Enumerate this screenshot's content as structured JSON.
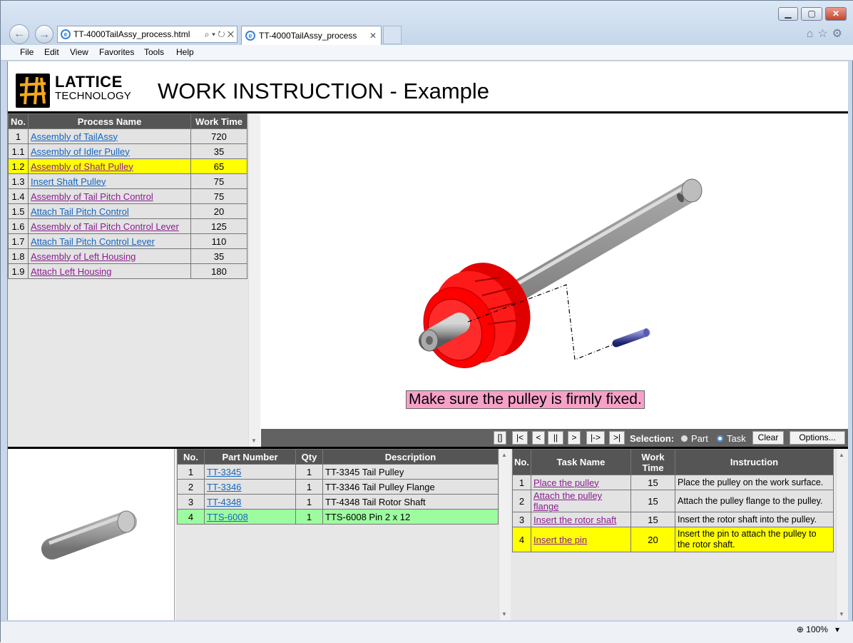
{
  "window": {
    "address": "TT-4000TailAssy_process.html",
    "tab_title": "TT-4000TailAssy_process",
    "zoom": "100%"
  },
  "menu": [
    "File",
    "Edit",
    "View",
    "Favorites",
    "Tools",
    "Help"
  ],
  "header": {
    "logo_line1": "LATTICE",
    "logo_line2": "TECHNOLOGY",
    "title": "WORK INSTRUCTION - Example"
  },
  "process_table": {
    "columns": [
      "No.",
      "Process Name",
      "Work Time"
    ],
    "rows": [
      {
        "no": "1",
        "name": "Assembly of TailAssy",
        "time": "720",
        "visited": false
      },
      {
        "no": "1.1",
        "name": "Assembly of Idler Pulley",
        "time": "35",
        "visited": false
      },
      {
        "no": "1.2",
        "name": "Assembly of Shaft Pulley",
        "time": "65",
        "visited": true,
        "selected": true
      },
      {
        "no": "1.3",
        "name": "Insert Shaft Pulley",
        "time": "75",
        "visited": false
      },
      {
        "no": "1.4",
        "name": "Assembly of Tail Pitch Control",
        "time": "75",
        "visited": true
      },
      {
        "no": "1.5",
        "name": "Attach Tail Pitch Control",
        "time": "20",
        "visited": false
      },
      {
        "no": "1.6",
        "name": "Assembly of Tail Pitch Control Lever",
        "time": "125",
        "visited": true
      },
      {
        "no": "1.7",
        "name": "Attach Tail Pitch Control Lever",
        "time": "110",
        "visited": false
      },
      {
        "no": "1.8",
        "name": "Assembly of Left Housing",
        "time": "35",
        "visited": true
      },
      {
        "no": "1.9",
        "name": "Attach Left Housing",
        "time": "180",
        "visited": true
      }
    ]
  },
  "viewer": {
    "caption": "Make sure the pulley is firmly fixed.",
    "controls": [
      "[]",
      "|<",
      "<",
      "||",
      ">",
      "|->",
      ">|"
    ],
    "selection_label": "Selection:",
    "radio_part": "Part",
    "radio_task": "Task",
    "selected_mode": "Task",
    "clear_label": "Clear",
    "options_label": "Options..."
  },
  "parts_table": {
    "columns": [
      "No.",
      "Part Number",
      "Qty",
      "Description"
    ],
    "rows": [
      {
        "no": "1",
        "part": "TT-3345",
        "qty": "1",
        "desc": "TT-3345 Tail Pulley"
      },
      {
        "no": "2",
        "part": "TT-3346",
        "qty": "1",
        "desc": "TT-3346 Tail Pulley Flange"
      },
      {
        "no": "3",
        "part": "TT-4348",
        "qty": "1",
        "desc": "TT-4348 Tail Rotor Shaft"
      },
      {
        "no": "4",
        "part": "TTS-6008",
        "qty": "1",
        "desc": "TTS-6008 Pin 2 x 12",
        "selected": true
      }
    ]
  },
  "task_table": {
    "columns": [
      "No.",
      "Task Name",
      "Work Time",
      "Instruction"
    ],
    "rows": [
      {
        "no": "1",
        "name": "Place the pulley",
        "time": "15",
        "instruction": "Place the pulley on the work surface."
      },
      {
        "no": "2",
        "name": "Attach the pulley flange",
        "time": "15",
        "instruction": "Attach the pulley flange to the pulley."
      },
      {
        "no": "3",
        "name": "Insert the rotor shaft",
        "time": "15",
        "instruction": "Insert the rotor shaft into the pulley."
      },
      {
        "no": "4",
        "name": "Insert the pin",
        "time": "20",
        "instruction": "Insert the pin to attach the pulley to the rotor shaft.",
        "selected": true
      }
    ]
  }
}
